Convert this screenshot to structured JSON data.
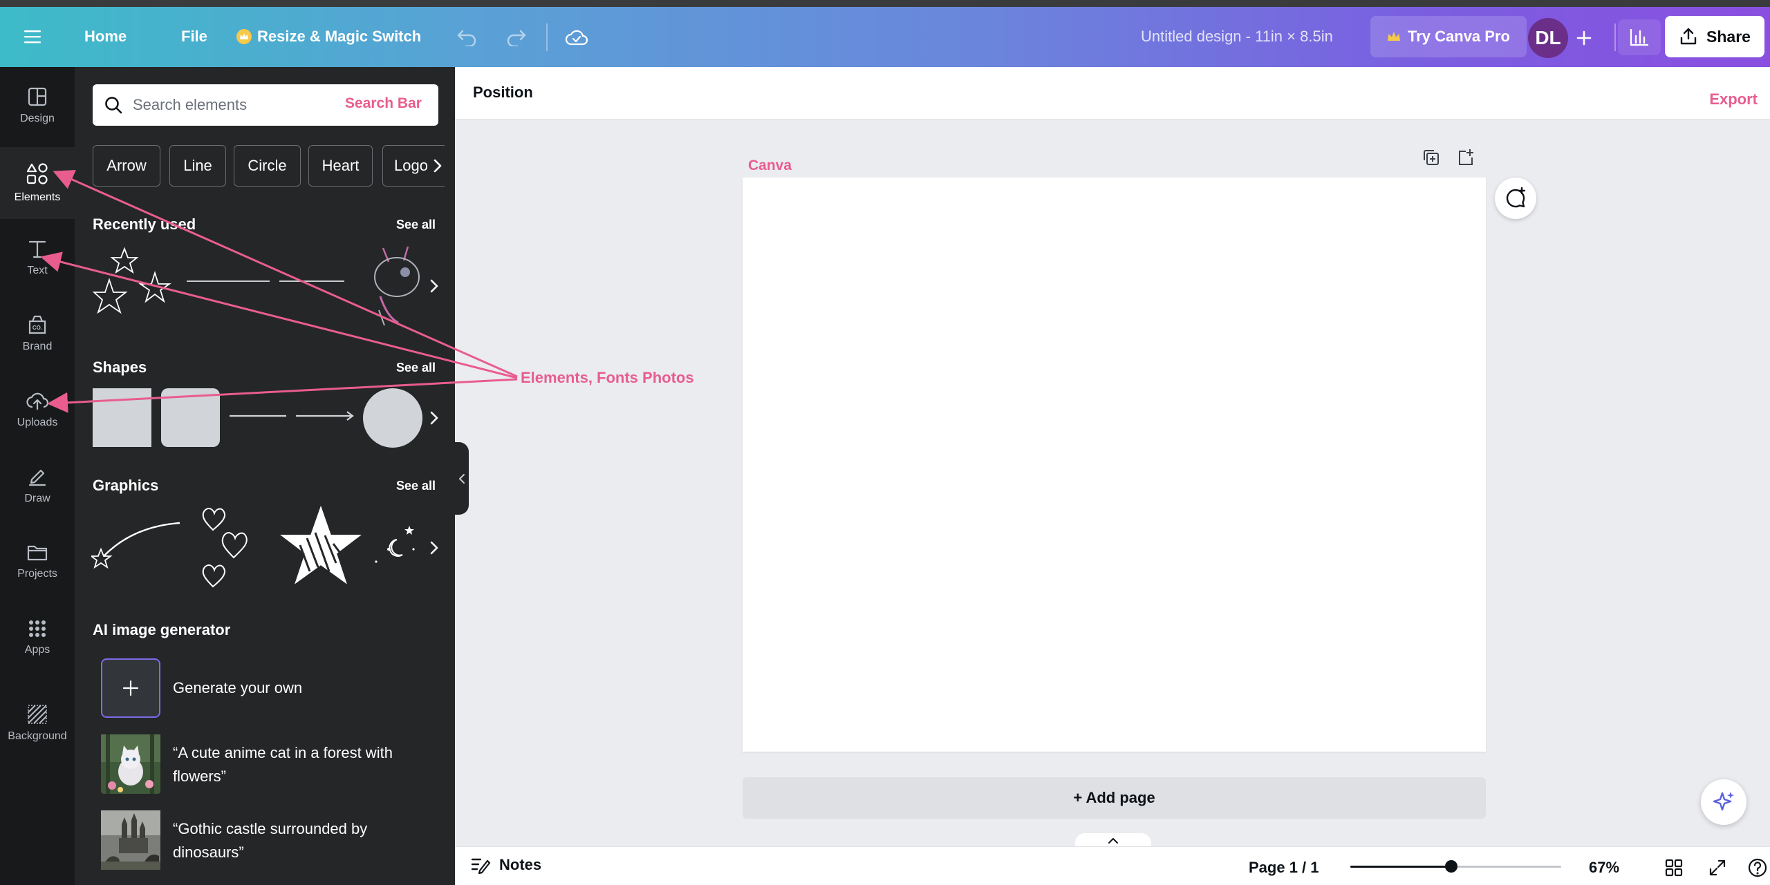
{
  "header": {
    "home": "Home",
    "file": "File",
    "resize": "Resize & Magic Switch",
    "design_title": "Untitled design - 11in × 8.5in",
    "try_pro": "Try Canva Pro",
    "avatar_initials": "DL",
    "share": "Share"
  },
  "rail": {
    "items": [
      {
        "label": "Design",
        "icon": "layout-icon"
      },
      {
        "label": "Elements",
        "icon": "shapes-icon",
        "active": true
      },
      {
        "label": "Text",
        "icon": "text-icon"
      },
      {
        "label": "Brand",
        "icon": "brand-icon"
      },
      {
        "label": "Uploads",
        "icon": "cloud-upload-icon"
      },
      {
        "label": "Draw",
        "icon": "pen-icon"
      },
      {
        "label": "Projects",
        "icon": "folder-icon"
      },
      {
        "label": "Apps",
        "icon": "apps-grid-icon"
      },
      {
        "label": "Background",
        "icon": "background-icon"
      }
    ]
  },
  "panel": {
    "search_placeholder": "Search elements",
    "search_annotation": "Search Bar",
    "chips": [
      "Arrow",
      "Line",
      "Circle",
      "Heart",
      "Logo"
    ],
    "recently_used": "Recently used",
    "shapes": "Shapes",
    "graphics": "Graphics",
    "see_all": "See all",
    "ai_title": "AI image generator",
    "ai_items": [
      "Generate your own",
      "“A cute anime cat in a forest with flowers”",
      "“Gothic castle surrounded by dinosaurs”"
    ]
  },
  "editor": {
    "position": "Position",
    "export_annotation": "Export",
    "canvas_annotation": "Canva",
    "add_page": "+ Add page",
    "annotation_label": "Elements, Fonts Photos"
  },
  "footer": {
    "notes": "Notes",
    "page": "Page 1 / 1",
    "zoom": "67%",
    "zoom_level": 0.48
  },
  "colors": {
    "annotation": "#e85d8e",
    "panel": "#252627",
    "rail": "#18191b"
  }
}
